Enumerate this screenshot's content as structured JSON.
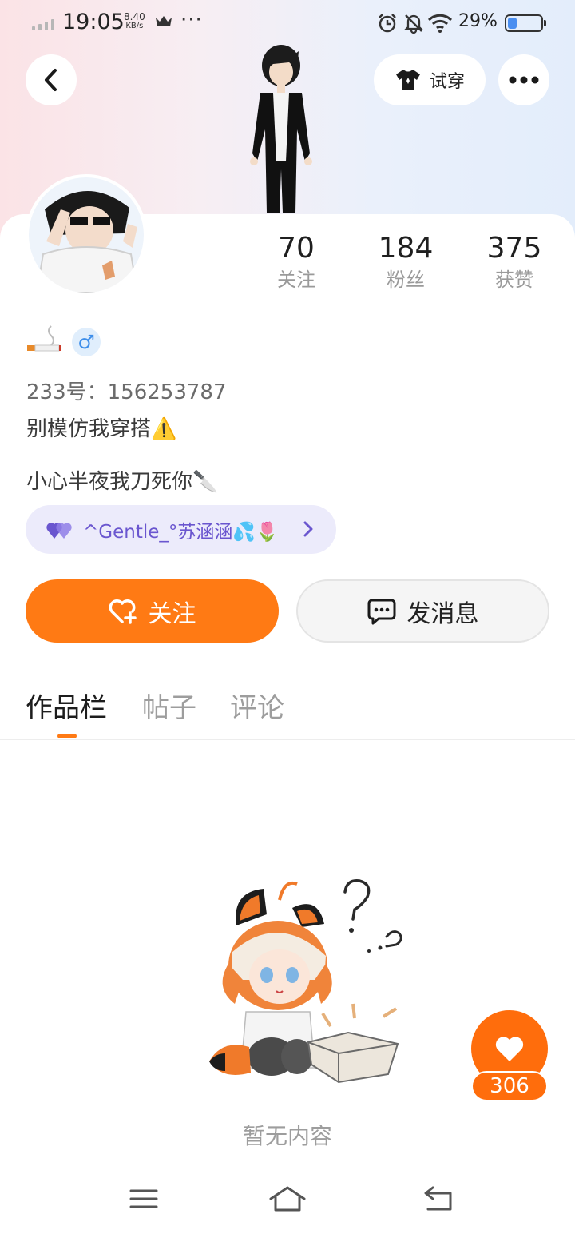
{
  "status_bar": {
    "time": "19:05",
    "net_speed_value": "8.40",
    "net_speed_unit": "KB/s",
    "battery": "29%"
  },
  "header": {
    "tryon_label": "试穿"
  },
  "stats": [
    {
      "value": "70",
      "label": "关注"
    },
    {
      "value": "184",
      "label": "粉丝"
    },
    {
      "value": "375",
      "label": "获赞"
    }
  ],
  "profile": {
    "uid": "233号：156253787",
    "bio_line1": "别模仿我穿搭⚠️",
    "bio_line2": "小心半夜我刀死你🔪",
    "gender_symbol": "♂",
    "cp_name": "^Gentle_°苏涵涵💦🌷"
  },
  "actions": {
    "follow_label": "关注",
    "message_label": "发消息"
  },
  "tabs": [
    {
      "label": "作品栏",
      "active": true
    },
    {
      "label": "帖子",
      "active": false
    },
    {
      "label": "评论",
      "active": false
    }
  ],
  "empty": {
    "text": "暂无内容"
  },
  "like": {
    "count": "306"
  },
  "colors": {
    "accent": "#ff7a14",
    "cp_text": "#6a56cf"
  }
}
